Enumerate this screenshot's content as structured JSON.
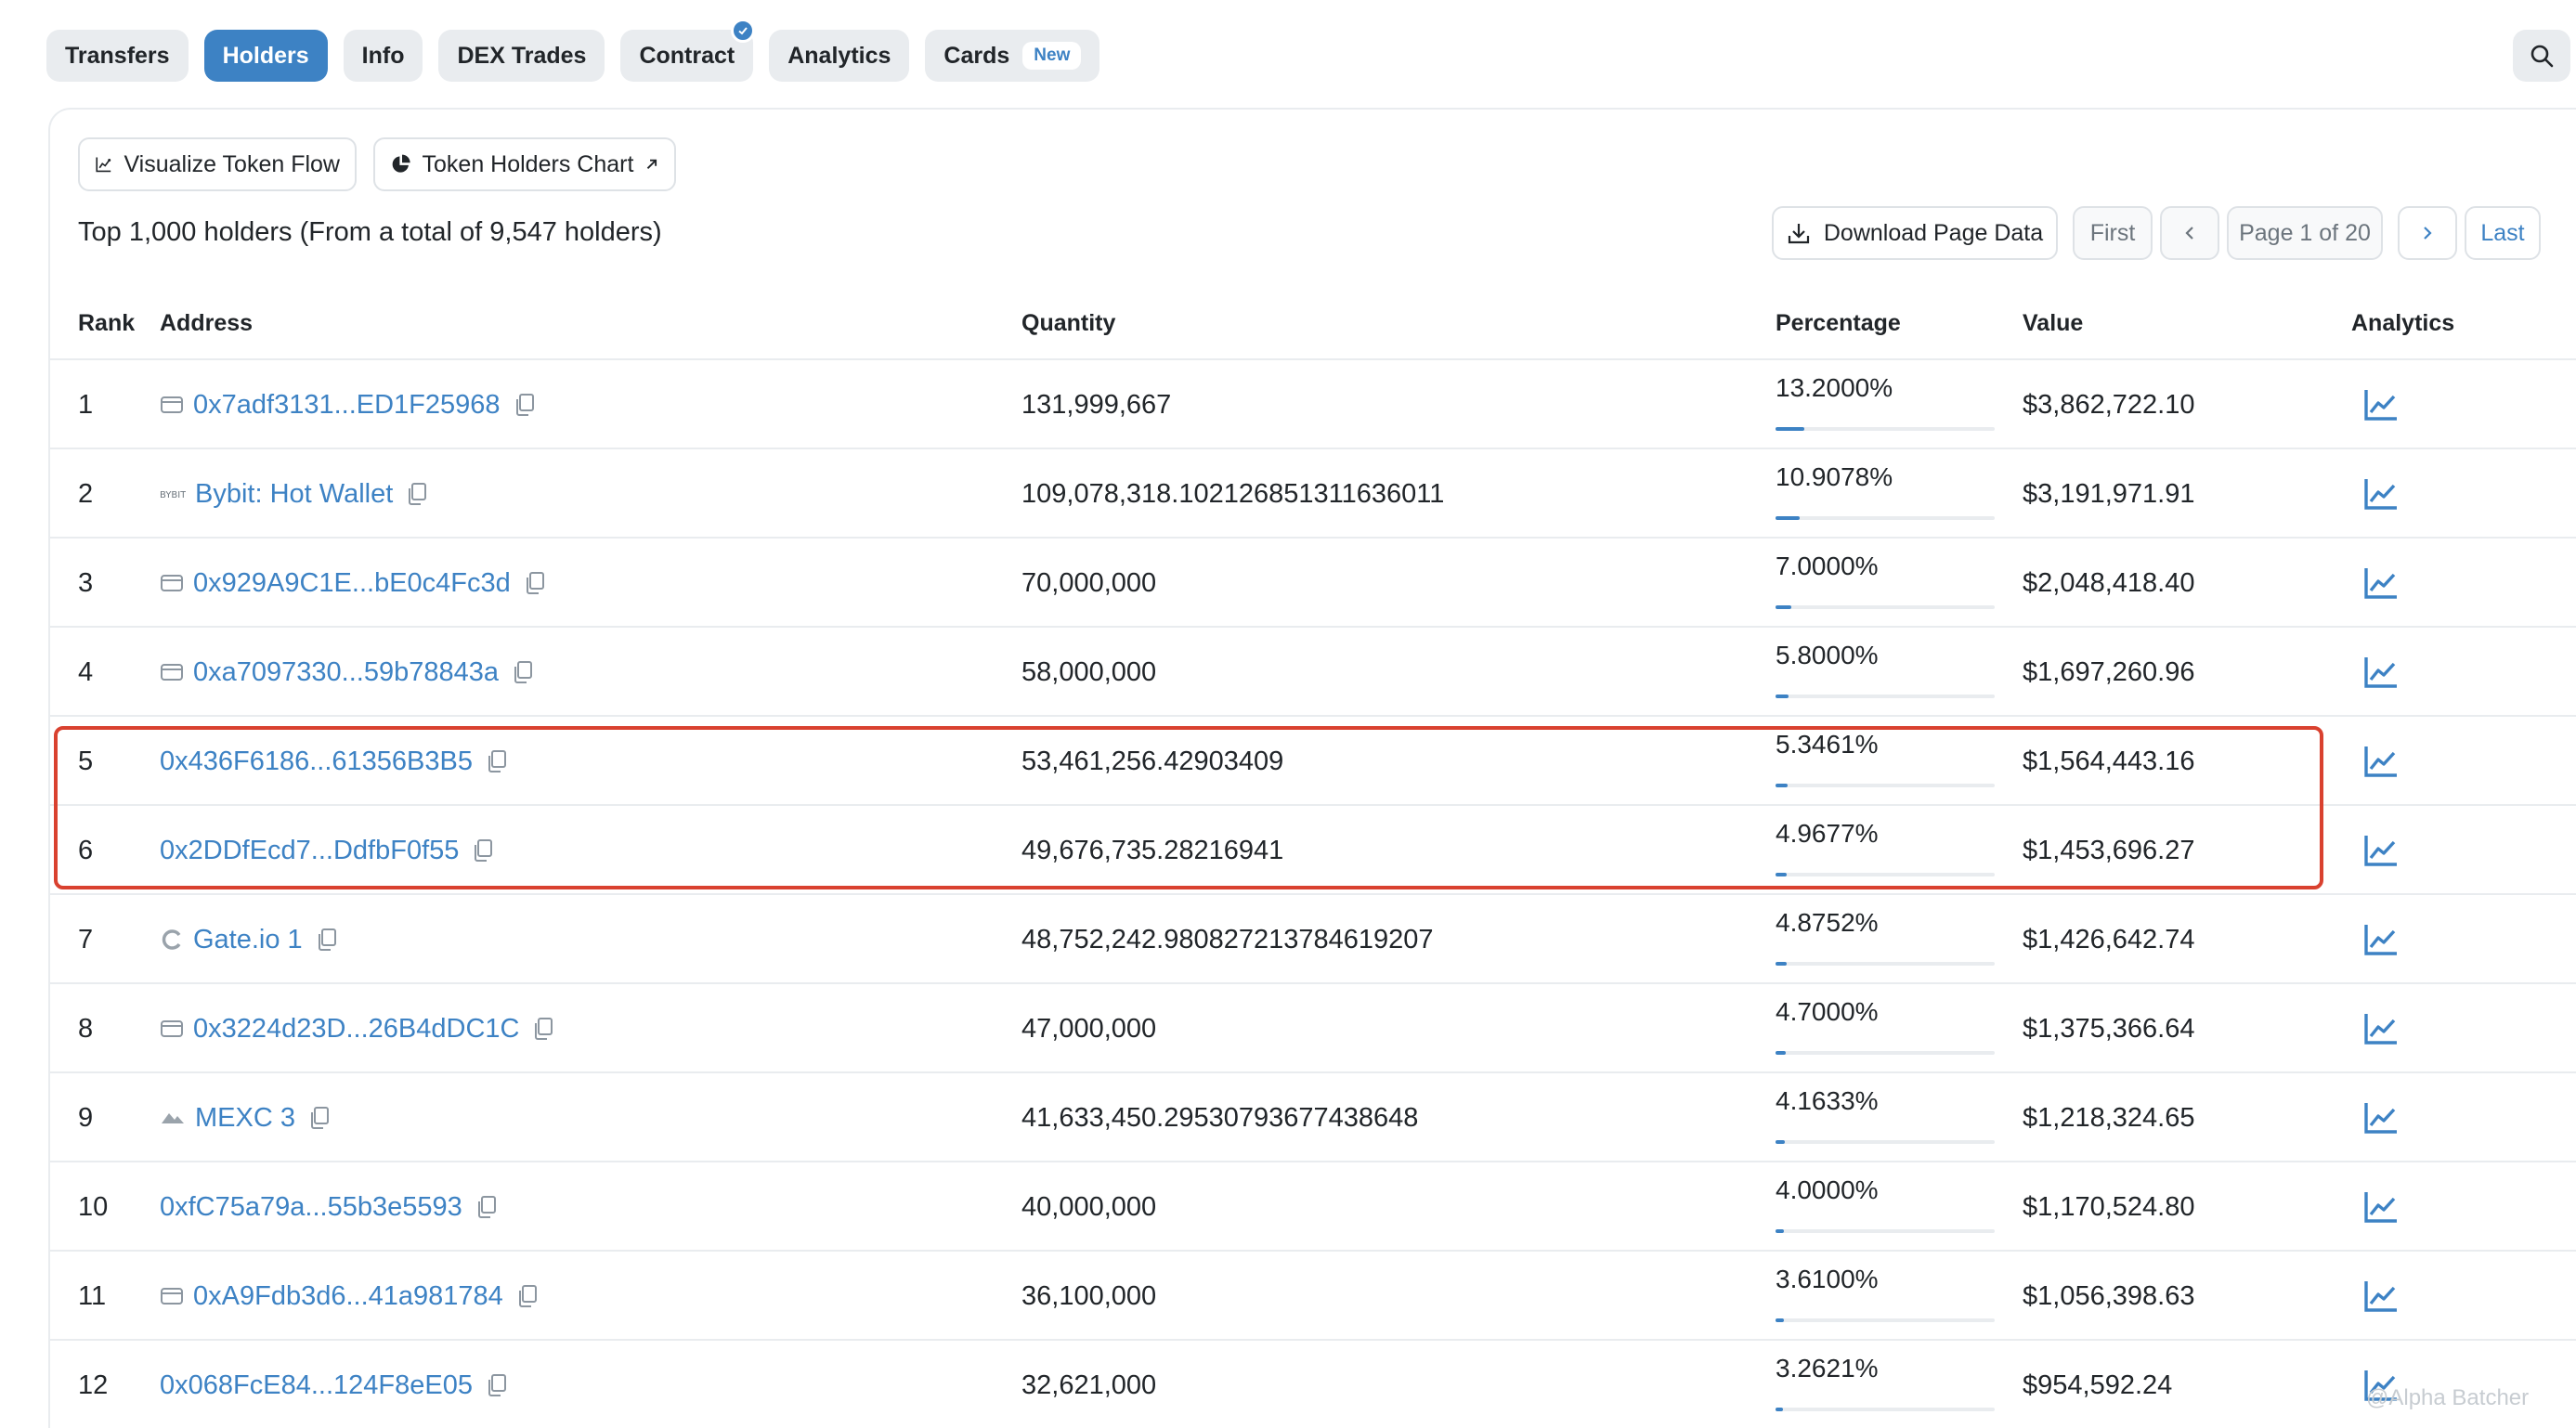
{
  "tabs": [
    {
      "label": "Transfers",
      "active": false
    },
    {
      "label": "Holders",
      "active": true
    },
    {
      "label": "Info",
      "active": false
    },
    {
      "label": "DEX Trades",
      "active": false
    },
    {
      "label": "Contract",
      "active": false,
      "verified": true
    },
    {
      "label": "Analytics",
      "active": false
    },
    {
      "label": "Cards",
      "active": false,
      "badge": "New"
    }
  ],
  "toolbar": {
    "visualize_label": "Visualize Token Flow",
    "chart_label": "Token Holders Chart"
  },
  "summary": "Top 1,000 holders (From a total of 9,547 holders)",
  "pager": {
    "download_label": "Download Page Data",
    "first_label": "First",
    "page_label": "Page 1 of 20",
    "last_label": "Last"
  },
  "table": {
    "headers": {
      "rank": "Rank",
      "address": "Address",
      "quantity": "Quantity",
      "percentage": "Percentage",
      "value": "Value",
      "analytics": "Analytics"
    },
    "rows": [
      {
        "rank": "1",
        "address": "0x7adf3131...ED1F25968",
        "icon": "wallet-icon",
        "quantity": "131,999,667",
        "percentage": "13.2000%",
        "pct": 13.2,
        "value": "$3,862,722.10"
      },
      {
        "rank": "2",
        "address": "Bybit: Hot Wallet",
        "icon": "bybit-logo-icon",
        "quantity": "109,078,318.102126851311636011",
        "percentage": "10.9078%",
        "pct": 10.9078,
        "value": "$3,191,971.91"
      },
      {
        "rank": "3",
        "address": "0x929A9C1E...bE0c4Fc3d",
        "icon": "wallet-icon",
        "quantity": "70,000,000",
        "percentage": "7.0000%",
        "pct": 7.0,
        "value": "$2,048,418.40"
      },
      {
        "rank": "4",
        "address": "0xa7097330...59b78843a",
        "icon": "wallet-icon",
        "quantity": "58,000,000",
        "percentage": "5.8000%",
        "pct": 5.8,
        "value": "$1,697,260.96"
      },
      {
        "rank": "5",
        "address": "0x436F6186...61356B3B5",
        "icon": "",
        "quantity": "53,461,256.42903409",
        "percentage": "5.3461%",
        "pct": 5.3461,
        "value": "$1,564,443.16"
      },
      {
        "rank": "6",
        "address": "0x2DDfEcd7...DdfbF0f55",
        "icon": "",
        "quantity": "49,676,735.28216941",
        "percentage": "4.9677%",
        "pct": 4.9677,
        "value": "$1,453,696.27"
      },
      {
        "rank": "7",
        "address": "Gate.io 1",
        "icon": "gate-logo-icon",
        "quantity": "48,752,242.980827213784619207",
        "percentage": "4.8752%",
        "pct": 4.8752,
        "value": "$1,426,642.74"
      },
      {
        "rank": "8",
        "address": "0x3224d23D...26B4dDC1C",
        "icon": "wallet-icon",
        "quantity": "47,000,000",
        "percentage": "4.7000%",
        "pct": 4.7,
        "value": "$1,375,366.64"
      },
      {
        "rank": "9",
        "address": "MEXC 3",
        "icon": "mexc-logo-icon",
        "quantity": "41,633,450.29530793677438648",
        "percentage": "4.1633%",
        "pct": 4.1633,
        "value": "$1,218,324.65"
      },
      {
        "rank": "10",
        "address": "0xfC75a79a...55b3e5593",
        "icon": "",
        "quantity": "40,000,000",
        "percentage": "4.0000%",
        "pct": 4.0,
        "value": "$1,170,524.80"
      },
      {
        "rank": "11",
        "address": "0xA9Fdb3d6...41a981784",
        "icon": "wallet-icon",
        "quantity": "36,100,000",
        "percentage": "3.6100%",
        "pct": 3.61,
        "value": "$1,056,398.63"
      },
      {
        "rank": "12",
        "address": "0x068FcE84...124F8eE05",
        "icon": "",
        "quantity": "32,621,000",
        "percentage": "3.2621%",
        "pct": 3.2621,
        "value": "$954,592.24"
      }
    ]
  },
  "watermark": "@Alpha Batcher",
  "colors": {
    "accent": "#3d82c4",
    "highlight": "#d9412f",
    "border": "#e9ecef"
  }
}
